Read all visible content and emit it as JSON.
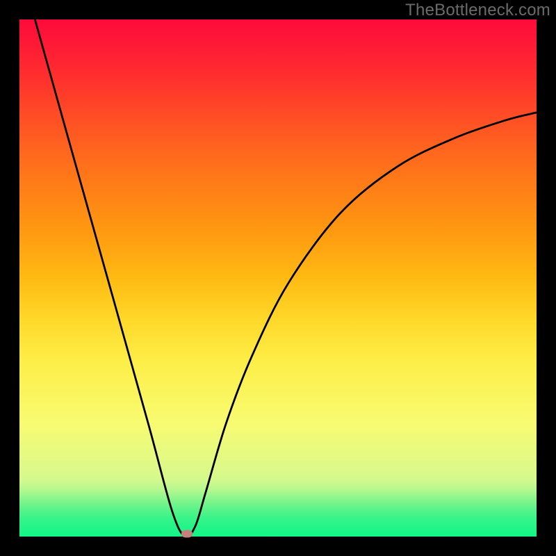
{
  "watermark": "TheBottleneck.com",
  "chart_data": {
    "type": "line",
    "title": "",
    "xlabel": "",
    "ylabel": "",
    "xlim": [
      0,
      100
    ],
    "ylim": [
      0,
      100
    ],
    "grid": false,
    "series": [
      {
        "name": "bottleneck-curve",
        "x": [
          3,
          10,
          18,
          25,
          29.5,
          32,
          34,
          36,
          40,
          45,
          52,
          62,
          73,
          84,
          94,
          100
        ],
        "y": [
          100,
          75,
          46.5,
          21.5,
          5,
          0,
          2,
          8.5,
          22,
          35,
          49,
          62.5,
          71.5,
          77,
          80.5,
          82
        ]
      }
    ],
    "annotations": [
      {
        "name": "minimum-marker",
        "x": 32.4,
        "y": 0.6
      }
    ],
    "colors": {
      "curve": "#000000",
      "marker": "#c6817c",
      "gradient_top": "#fe0a3b",
      "gradient_mid": "#ffd829",
      "gradient_bottom": "#12f588",
      "frame": "#000000"
    }
  }
}
